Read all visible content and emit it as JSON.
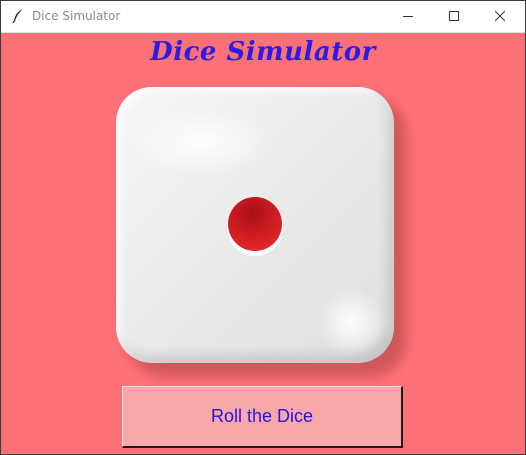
{
  "window": {
    "title": "Dice Simulator",
    "background_color": "#ff7176",
    "controls": {
      "minimize_icon": "minimize-icon",
      "maximize_icon": "maximize-icon",
      "close_icon": "close-icon"
    }
  },
  "app_icon": "feather-icon",
  "heading": {
    "text": "Dice Simulator",
    "color": "#2b1be3"
  },
  "die": {
    "face_value": 1,
    "pip_color": "#d8222a"
  },
  "roll_button": {
    "label": "Roll the Dice",
    "background_color": "#faa8ab",
    "text_color": "#2612d8"
  }
}
